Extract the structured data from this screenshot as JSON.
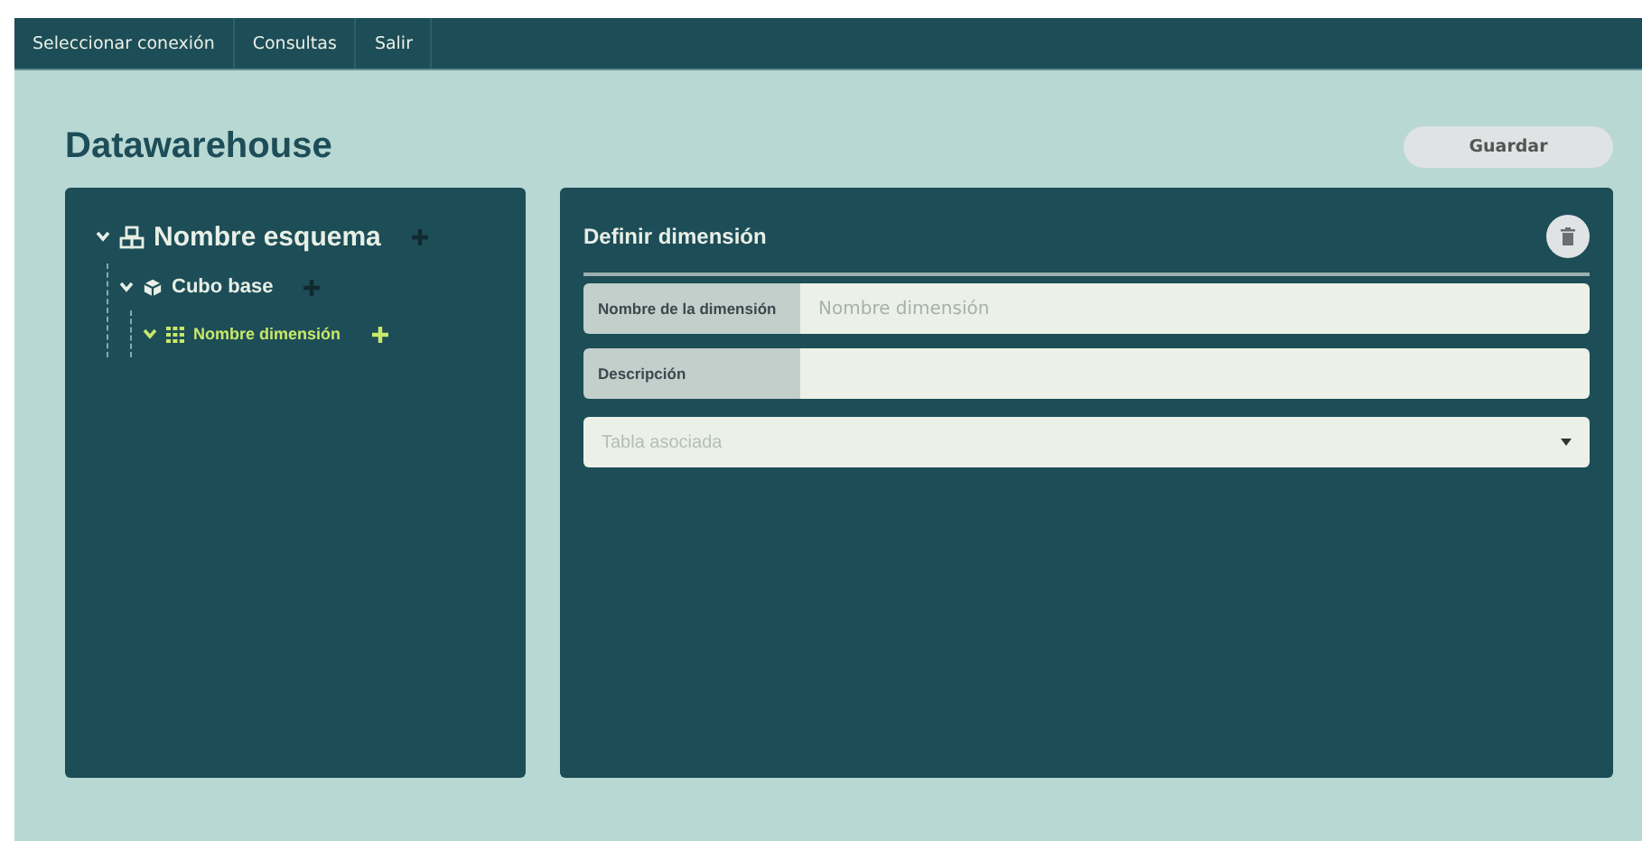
{
  "menu": [
    {
      "label": "Seleccionar conexión"
    },
    {
      "label": "Consultas"
    },
    {
      "label": "Salir"
    }
  ],
  "title": "Datawarehouse",
  "save_button": "Guardar",
  "tree": [
    {
      "label": "Nombre esquema",
      "kind": "schema",
      "expanded": true,
      "selected": false,
      "children": [
        {
          "label": "Cubo base",
          "kind": "cube",
          "expanded": true,
          "selected": false,
          "children": [
            {
              "label": "Nombre dimensión",
              "kind": "dimension",
              "expanded": true,
              "selected": true
            }
          ]
        }
      ]
    }
  ],
  "form": {
    "title": "Definir dimensión",
    "fields": [
      {
        "kind": "text",
        "label": "Nombre de la dimensión",
        "placeholder": "Nombre dimensión"
      },
      {
        "kind": "text",
        "label": "Descripción"
      },
      {
        "kind": "select",
        "placeholder": "Tabla asociada"
      }
    ]
  }
}
